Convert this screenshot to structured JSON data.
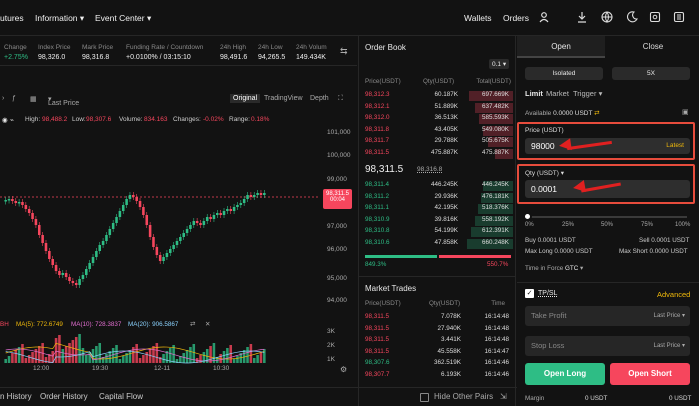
{
  "nav": {
    "items": [
      "utures",
      "Information",
      "Event Center"
    ],
    "right": [
      "Wallets",
      "Orders"
    ],
    "icons": [
      "user-icon",
      "download-icon",
      "globe-icon",
      "moon-icon",
      "settings-icon",
      "menu-icon"
    ]
  },
  "stats": [
    {
      "label": "Change",
      "value": "+2.75%",
      "tone": "green"
    },
    {
      "label": "Index Price",
      "value": "98,326.0",
      "tone": "normal"
    },
    {
      "label": "Mark Price",
      "value": "98,316.8",
      "tone": "normal"
    },
    {
      "label": "Funding Rate / Countdown",
      "value": "+0.0100% / 03:15:10",
      "tone": "normal"
    },
    {
      "label": "24h High",
      "value": "98,491.6",
      "tone": "normal"
    },
    {
      "label": "24h Low",
      "value": "94,265.5",
      "tone": "normal"
    },
    {
      "label": "24h Volum",
      "value": "149.434K",
      "tone": "normal"
    }
  ],
  "toolbar": {
    "price_type": "Last Price",
    "views": [
      "Original",
      "TradingView",
      "Depth"
    ]
  },
  "ohlc": {
    "high_label": "High:",
    "high": "98,488.2",
    "low_label": "Low:",
    "low": "98,307.6",
    "volume_label": "Volume:",
    "volume": "834.163",
    "changes_label": "Changes:",
    "changes": "-0.02%",
    "range_label": "Range:",
    "range": "0.18%"
  },
  "chart_axis": {
    "y_ticks": [
      "101,000",
      "100,000",
      "99,000",
      "97,000",
      "96,000",
      "95,000",
      "94,000"
    ],
    "price_tag": "98,311.5",
    "price_tag_time": "00:04",
    "x_ticks": [
      "12:00",
      "19:30",
      "12-11",
      "10:30"
    ],
    "vol_ticks": [
      "3K",
      "2K",
      "1K"
    ]
  },
  "ma": {
    "label_prefix": "BH",
    "ma5": "MA(5): 772.6749",
    "ma10": "MA(10): 728.3837",
    "ma20": "MA(20): 906.5867"
  },
  "bottom_tabs": [
    "n History",
    "Order History",
    "Capital Flow"
  ],
  "hide_pairs": "Hide Other Pairs",
  "orderbook": {
    "title": "Order Book",
    "precision": "0.1",
    "headers": [
      "Price(USDT)",
      "Qty(USDT)",
      "Total(USDT)"
    ],
    "asks": [
      [
        "98,312.3",
        "60.187K",
        "697.669K"
      ],
      [
        "98,312.1",
        "51.889K",
        "637.482K"
      ],
      [
        "98,312.0",
        "36.513K",
        "585.593K"
      ],
      [
        "98,311.8",
        "43.405K",
        "549.080K"
      ],
      [
        "98,311.7",
        "29.788K",
        "505.675K"
      ],
      [
        "98,311.5",
        "475.887K",
        "475.887K"
      ]
    ],
    "last_price": "98,311.5",
    "mark_price": "98,316.8",
    "bids": [
      [
        "98,311.4",
        "446.245K",
        "446.245K"
      ],
      [
        "98,311.2",
        "29.936K",
        "476.181K"
      ],
      [
        "98,311.1",
        "42.195K",
        "518.376K"
      ],
      [
        "98,310.9",
        "39.816K",
        "558.192K"
      ],
      [
        "98,310.8",
        "54.199K",
        "612.391K"
      ],
      [
        "98,310.6",
        "47.858K",
        "660.248K"
      ]
    ],
    "buy_ratio": "849.3%",
    "sell_ratio": "550.7%"
  },
  "trades": {
    "title": "Market Trades",
    "headers": [
      "Price(USDT)",
      "Qty(USDT)",
      "Time"
    ],
    "rows": [
      [
        "98,311.5",
        "7.078K",
        "16:14:48",
        "red"
      ],
      [
        "98,311.5",
        "27.940K",
        "16:14:48",
        "red"
      ],
      [
        "98,311.5",
        "3.441K",
        "16:14:48",
        "red"
      ],
      [
        "98,311.5",
        "45.558K",
        "16:14:47",
        "red"
      ],
      [
        "98,307.6",
        "362.519K",
        "16:14:46",
        "green"
      ],
      [
        "98,307.7",
        "6.193K",
        "16:14:46",
        "red"
      ]
    ]
  },
  "trade_panel": {
    "tabs": [
      "Open",
      "Close"
    ],
    "margin_mode": "Isolated",
    "leverage": "5X",
    "order_types": [
      "Limit",
      "Market",
      "Trigger"
    ],
    "available_label": "Available",
    "available": "0.0000 USDT",
    "price_label": "Price (USDT)",
    "price_value": "98000",
    "latest": "Latest",
    "qty_label": "Qty (USDT)",
    "qty_value": "0.0001",
    "slider_ticks": [
      "0%",
      "25%",
      "50%",
      "75%",
      "100%"
    ],
    "buy_info": "Buy 0.0001 USDT",
    "sell_info": "Sell 0.0001 USDT",
    "max_long": "Max Long 0.0000 USDT",
    "max_short": "Max Short 0.0000 USDT",
    "tif_label": "Time in Force",
    "tif_value": "GTC",
    "tpsl": "TP/SL",
    "advanced": "Advanced",
    "take_profit": "Take Profit",
    "stop_loss": "Stop Loss",
    "last_price_opt": "Last Price",
    "open_long": "Open Long",
    "open_short": "Open Short",
    "margin_label": "Margin",
    "margin_long": "0 USDT",
    "margin_short": "0 USDT"
  },
  "colors": {
    "up": "#2ebd85",
    "down": "#f6465d",
    "accent": "#f0b90b",
    "annotation": "#e02020"
  }
}
